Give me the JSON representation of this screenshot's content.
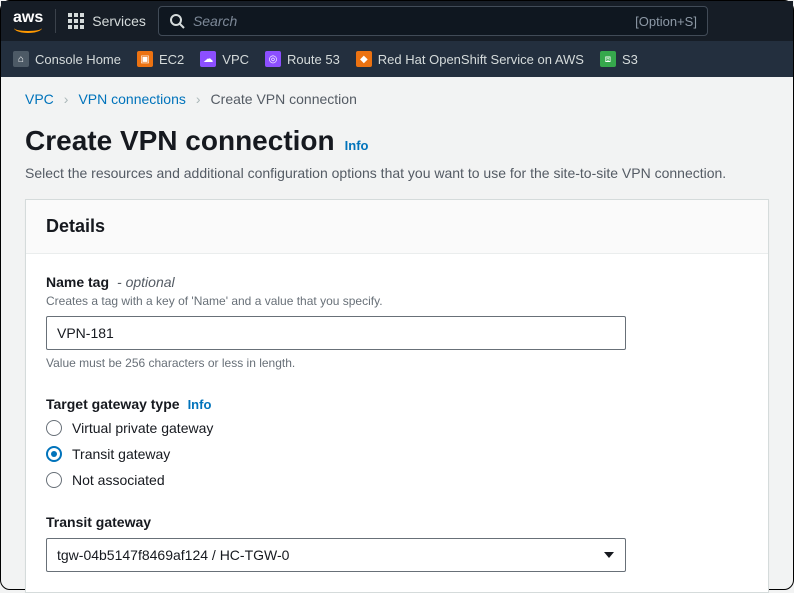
{
  "topnav": {
    "logo": "aws",
    "services_label": "Services",
    "search_placeholder": "Search",
    "search_kbd": "[Option+S]"
  },
  "svcbar": {
    "items": [
      {
        "label": "Console Home",
        "color": "#4d5a66"
      },
      {
        "label": "EC2",
        "color": "#ec7211"
      },
      {
        "label": "VPC",
        "color": "#8c4fff"
      },
      {
        "label": "Route 53",
        "color": "#8c4fff"
      },
      {
        "label": "Red Hat OpenShift Service on AWS",
        "color": "#ec7211"
      },
      {
        "label": "S3",
        "color": "#36a84c"
      }
    ]
  },
  "breadcrumbs": {
    "vpc": "VPC",
    "vpn_conns": "VPN connections",
    "current": "Create VPN connection"
  },
  "page": {
    "title": "Create VPN connection",
    "info": "Info",
    "subtitle": "Select the resources and additional configuration options that you want to use for the site-to-site VPN connection."
  },
  "panel": {
    "header": "Details"
  },
  "name_tag": {
    "label": "Name tag",
    "optional": "- optional",
    "desc": "Creates a tag with a key of 'Name' and a value that you specify.",
    "value": "VPN-181",
    "constraint": "Value must be 256 characters or less in length."
  },
  "target_gateway": {
    "label": "Target gateway type",
    "info": "Info",
    "options": {
      "vpg": "Virtual private gateway",
      "tgw": "Transit gateway",
      "none": "Not associated"
    },
    "selected": "tgw"
  },
  "transit_gateway": {
    "label": "Transit gateway",
    "value": "tgw-04b5147f8469af124 / HC-TGW-0"
  }
}
